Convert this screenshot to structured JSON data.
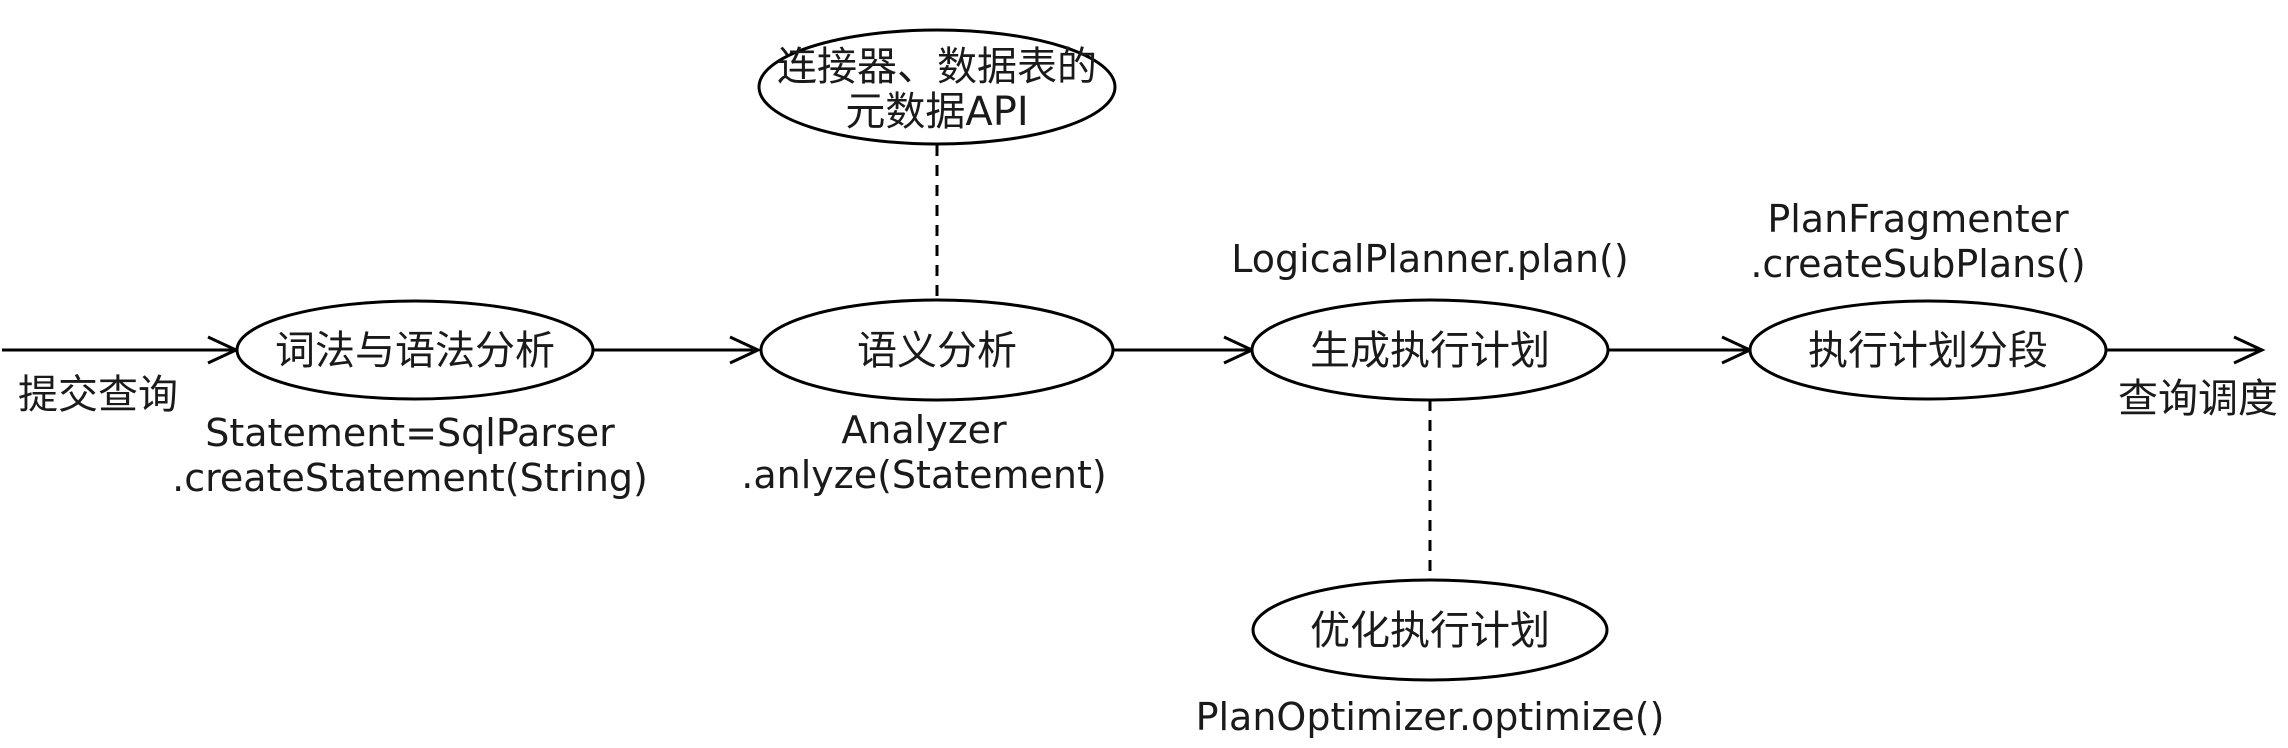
{
  "input_label": "提交查询",
  "output_label": "查询调度",
  "nodes": {
    "lex_parse": {
      "label": "词法与语法分析",
      "api_line1": "Statement=SqlParser",
      "api_line2": ".createStatement(String)"
    },
    "semantic": {
      "label": "语义分析",
      "api_line1": "Analyzer",
      "api_line2": ".anlyze(Statement)"
    },
    "metadata": {
      "label_line1": "连接器、数据表的",
      "label_line2": "元数据API"
    },
    "plan_gen": {
      "label": "生成执行计划",
      "api_line1": "LogicalPlanner.plan()"
    },
    "fragment": {
      "label": "执行计划分段",
      "api_line1": "PlanFragmenter",
      "api_line2": ".createSubPlans()"
    },
    "optimize": {
      "label": "优化执行计划",
      "api_line1": "PlanOptimizer.optimize()"
    }
  }
}
